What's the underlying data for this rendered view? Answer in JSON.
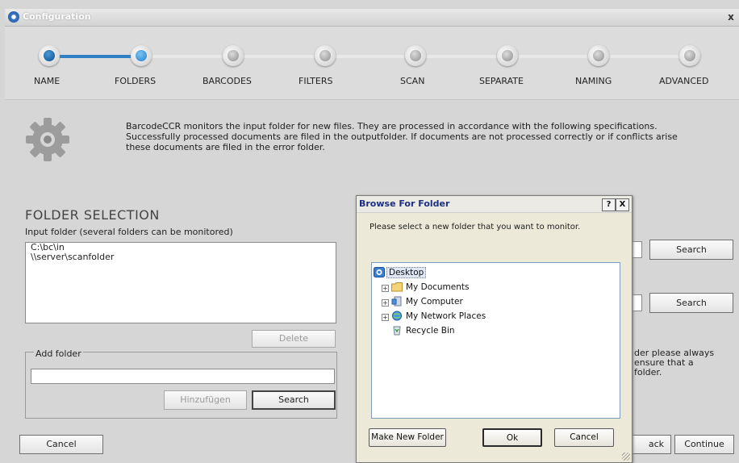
{
  "window": {
    "title": "Configuration",
    "close_label": "x"
  },
  "steps": [
    {
      "label": "NAME",
      "state": "done"
    },
    {
      "label": "FOLDERS",
      "state": "current"
    },
    {
      "label": "BARCODES",
      "state": "todo"
    },
    {
      "label": "FILTERS",
      "state": "todo"
    },
    {
      "label": "SCAN",
      "state": "todo"
    },
    {
      "label": "SEPARATE",
      "state": "todo"
    },
    {
      "label": "NAMING",
      "state": "todo"
    },
    {
      "label": "ADVANCED",
      "state": "todo"
    }
  ],
  "info": {
    "icon": "gear-icon",
    "lines": [
      "BarcodeCCR monitors the input folder for new files. They are processed in accordance with the following specifications.",
      "Successfully processed documents are filed in the outputfolder. If documents are not processed correctly or if conflicts arise",
      "these documents are filed in the error folder."
    ]
  },
  "folder_selection": {
    "title": "FOLDER SELECTION",
    "input_label": "Input folder (several folders can be monitored)",
    "folders": [
      "C:\\bc\\in",
      "\\\\server\\scanfolder"
    ],
    "delete_label": "Delete",
    "add_folder": {
      "legend": "Add folder",
      "value": "",
      "add_label": "Hinzufügen",
      "search_label": "Search"
    }
  },
  "right_panel": {
    "search1_label": "Search",
    "search2_label": "Search",
    "note_lines": [
      "der please always",
      "ensure that a",
      "folder."
    ],
    "back_label": "ack",
    "continue_label": "Continue"
  },
  "footer": {
    "cancel_label": "Cancel"
  },
  "browse_dialog": {
    "title": "Browse For Folder",
    "help_label": "?",
    "close_label": "X",
    "prompt": "Please select a new folder that you want to monitor.",
    "tree": [
      {
        "label": "Desktop",
        "icon": "desktop-icon",
        "selected": true,
        "expandable": false
      },
      {
        "label": "My Documents",
        "icon": "folder-icon",
        "selected": false,
        "expandable": true
      },
      {
        "label": "My Computer",
        "icon": "computer-icon",
        "selected": false,
        "expandable": true
      },
      {
        "label": "My Network Places",
        "icon": "network-icon",
        "selected": false,
        "expandable": true
      },
      {
        "label": "Recycle Bin",
        "icon": "recycle-bin-icon",
        "selected": false,
        "expandable": false
      }
    ],
    "new_folder_label": "Make New Folder",
    "ok_label": "Ok",
    "cancel_label": "Cancel"
  }
}
